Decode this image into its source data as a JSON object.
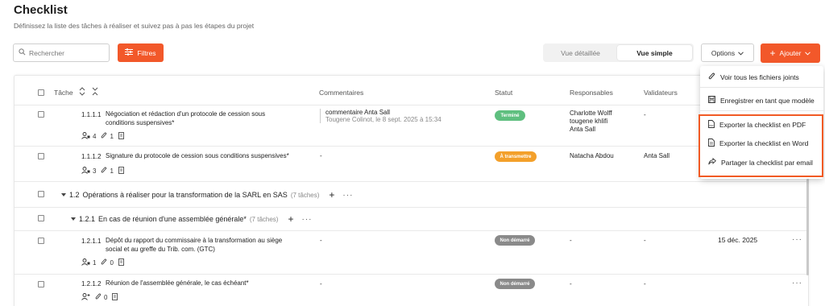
{
  "page": {
    "title": "Checklist",
    "subtitle": "Définissez la liste des tâches à réaliser et suivez pas à pas les étapes du projet"
  },
  "toolbar": {
    "search_placeholder": "Rechercher",
    "filters_label": "Filtres",
    "view_detailed": "Vue détaillée",
    "view_simple": "Vue simple",
    "options_label": "Options",
    "add_label": "Ajouter"
  },
  "table": {
    "headers": {
      "task": "Tâche",
      "comments": "Commentaires",
      "status": "Statut",
      "responsables": "Responsables",
      "validators": "Validateurs"
    }
  },
  "rows": [
    {
      "number": "1.1.1.1",
      "title_line1": "Négociation et rédaction d'un protocole de cession sous",
      "title_line2": "conditions suspensives*",
      "assignees": "4",
      "attachments": "1",
      "comment_text": "commentaire Anta Sall",
      "comment_meta": "Tougene Colinot, le 8 sept. 2025 à 15:34",
      "status": "Terminé",
      "responsables": [
        "Charlotte Wolff",
        "tougene khlifi",
        "Anta Sall"
      ],
      "validator": "-"
    },
    {
      "number": "1.1.1.2",
      "title_line1": "Signature du protocole de cession sous conditions suspensives*",
      "assignees": "3",
      "attachments": "1",
      "comment_text": "-",
      "status": "À transmettre",
      "responsables": [
        "Natacha Abdou"
      ],
      "validator": "Anta Sall"
    },
    {
      "number": "1.2.1.1",
      "title_line1": "Dépôt du rapport du commissaire à la transformation au siège",
      "title_line2": "social et au greffe du Trib. com. (GTC)",
      "assignees": "1",
      "attachments": "0",
      "comment_text": "-",
      "status": "Non démarré",
      "responsables": [
        "-"
      ],
      "validator": "-",
      "due_date": "15 déc. 2025"
    },
    {
      "number": "1.2.1.2",
      "title_line1": "Réunion de l'assemblée générale, le cas échéant*",
      "attachments": "0",
      "comment_text": "-",
      "status": "Non démarré",
      "responsables": [
        "-"
      ],
      "validator": "-"
    }
  ],
  "groups": [
    {
      "number": "1.2",
      "title": "Opérations à réaliser pour la transformation de la SARL en SAS",
      "count": "(7 tâches)"
    },
    {
      "number": "1.2.1",
      "title": "En cas de réunion d'une assemblée générale*",
      "count": "(7 tâches)"
    }
  ],
  "options_menu": {
    "items": [
      "Voir tous les fichiers joints",
      "Enregistrer en tant que modèle",
      "Exporter la checklist en PDF",
      "Exporter la checklist en Word",
      "Partager la checklist par email"
    ]
  },
  "colors": {
    "accent": "#f2582a",
    "status_done": "#5fbf7f",
    "status_to_send": "#f3a02b",
    "status_not_started": "#8a8a8a",
    "highlight": "#f15a24"
  }
}
